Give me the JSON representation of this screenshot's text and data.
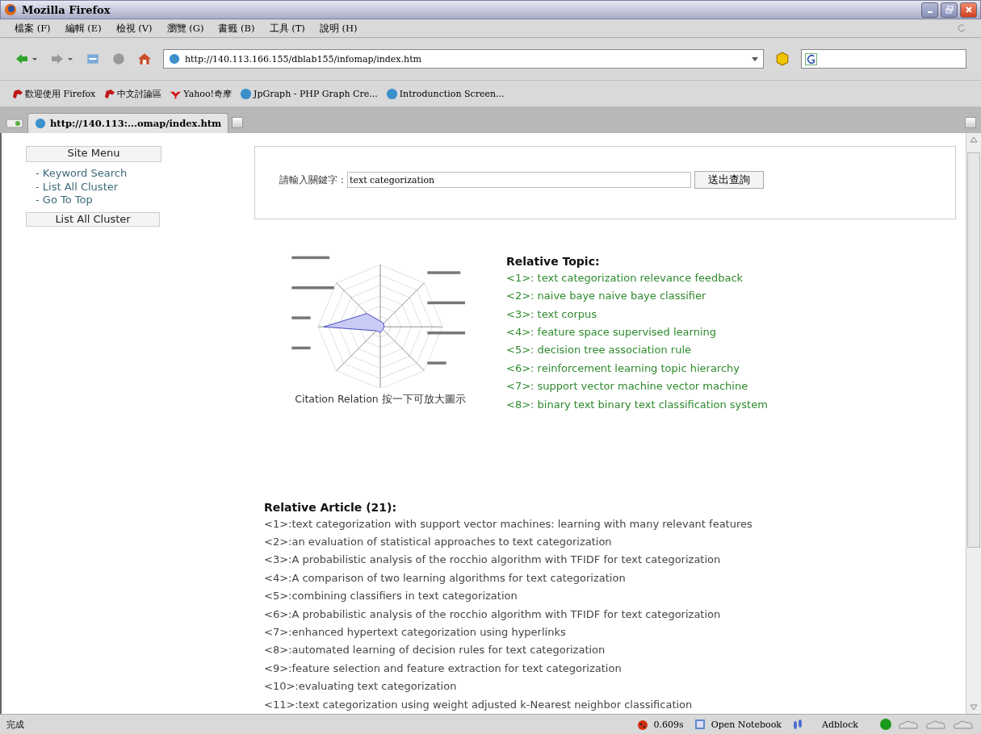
{
  "window": {
    "title": "Mozilla Firefox"
  },
  "menu": [
    "檔案 (F)",
    "編輯 (E)",
    "檢視 (V)",
    "瀏覽 (G)",
    "書籤 (B)",
    "工具 (T)",
    "說明 (H)"
  ],
  "address": {
    "value": "http://140.113.166.155/dblab155/infomap/index.htm"
  },
  "bookmarks": [
    {
      "label": "歡迎使用 Firefox",
      "kind": "fox"
    },
    {
      "label": "中文討論區",
      "kind": "fox"
    },
    {
      "label": "Yahoo!奇摩",
      "kind": "yahoo"
    },
    {
      "label": "JpGraph - PHP Graph Cre...",
      "kind": "globe"
    },
    {
      "label": "Introdunction Screen...",
      "kind": "globe"
    }
  ],
  "tabs": [
    {
      "label": "http://140.113:...omap/index.htm",
      "selected": true
    }
  ],
  "site_menu": {
    "title": "Site Menu",
    "links": [
      "- Keyword Search",
      "- List All Cluster",
      "- Go To Top"
    ],
    "button": "List All Cluster"
  },
  "search": {
    "label": "請輸入關鍵字：",
    "value": "text categorization",
    "button": "送出查詢"
  },
  "chart_caption": "Citation Relation 按一下可放大圖示",
  "relative_topic": {
    "title": "Relative Topic:",
    "items": [
      "<1>: text categorization relevance feedback",
      "<2>: naive baye naive baye classifier",
      "<3>: text corpus",
      "<4>: feature space supervised learning",
      "<5>: decision tree association rule",
      "<6>: reinforcement learning topic hierarchy",
      "<7>: support vector machine vector machine",
      "<8>: binary text binary text classification system"
    ]
  },
  "relative_article": {
    "title": "Relative Article (21):",
    "items": [
      "<1>:text categorization with support vector machines: learning with many relevant features",
      "<2>:an evaluation of statistical approaches to text categorization",
      "<3>:A probabilistic analysis of the rocchio algorithm with TFIDF for text categorization",
      "<4>:A comparison of two learning algorithms for text categorization",
      "<5>:combining classifiers in text categorization",
      "<6>:A probabilistic analysis of the rocchio algorithm with TFIDF for text categorization",
      "<7>:enhanced hypertext categorization using hyperlinks",
      "<8>:automated learning of decision rules for text categorization",
      "<9>:feature selection and feature extraction for text categorization",
      "<10>:evaluating text categorization",
      "<11>:text categorization using weight adjusted k-Nearest neighbor classification"
    ]
  },
  "status_bar": {
    "text": "完成",
    "timing": "0.609s",
    "notebook": "Open Notebook",
    "adblock": "Adblock"
  }
}
